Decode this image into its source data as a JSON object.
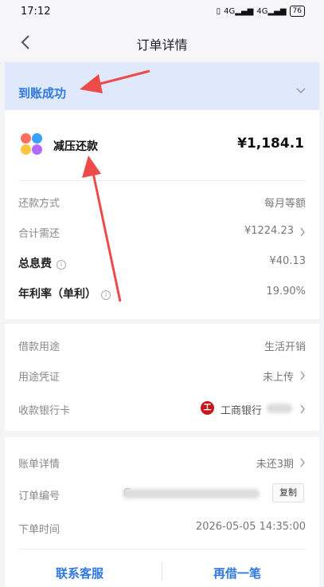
{
  "status_bar": {
    "time": "17:12",
    "signal_text": "4G",
    "battery": "76"
  },
  "nav": {
    "title": "订单详情"
  },
  "order_status": {
    "text": "到账成功",
    "color": "#2f78e0"
  },
  "product": {
    "name": "减压还款",
    "amount": "¥1,184.1"
  },
  "repayment": {
    "method_label": "还款方式",
    "method_value": "每月等额",
    "total_label": "合计需还",
    "total_value": "¥1224.23",
    "interest_label": "总息费",
    "interest_value": "¥40.13",
    "rate_label": "年利率（单利）",
    "rate_value": "19.90%"
  },
  "loan": {
    "purpose_label": "借款用途",
    "purpose_value": "生活开销",
    "proof_label": "用途凭证",
    "proof_value": "未上传",
    "bank_label": "收款银行卡",
    "bank_name": "工商银行",
    "bank_logo_char": "工"
  },
  "order": {
    "bill_label": "账单详情",
    "bill_value": "未还3期",
    "number_label": "订单编号",
    "number_prefix": "C",
    "copy_label": "复制",
    "time_label": "下单时间",
    "time_value": "2026-05-05 14:35:00"
  },
  "actions": {
    "contact_label": "联系客服",
    "borrow_again_label": "再借一笔"
  },
  "colors": {
    "accent": "#2f78e0",
    "banner": "#dfe9fb",
    "annotation_arrow": "#ee4a4a"
  }
}
